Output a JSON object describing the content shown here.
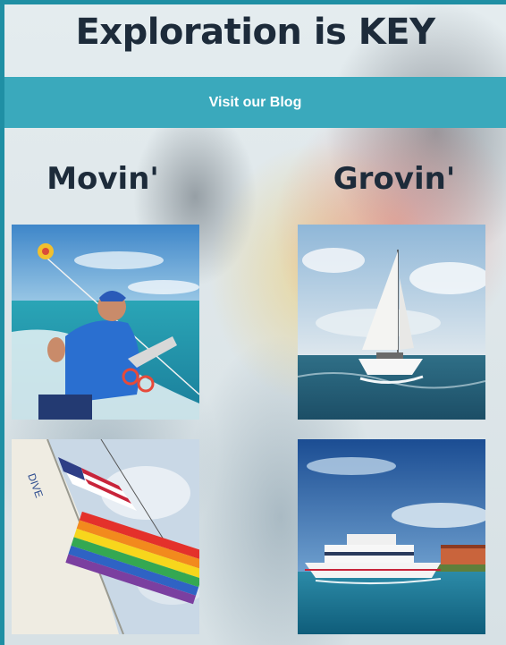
{
  "header": {
    "title": "Exploration is KEY"
  },
  "blog_button": {
    "label": "Visit our Blog"
  },
  "columns": [
    {
      "title": "Movin'"
    },
    {
      "title": "Grovin'"
    }
  ],
  "colors": {
    "accent": "#3aa9bc",
    "border": "#1f8fa4",
    "heading": "#1d2b3a"
  }
}
